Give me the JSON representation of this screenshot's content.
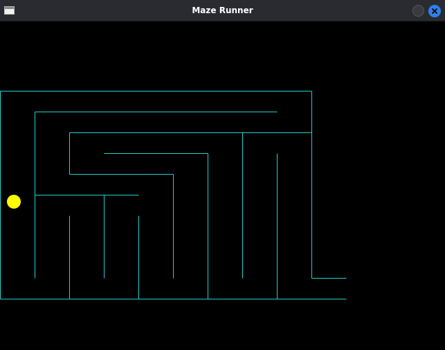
{
  "window": {
    "title": "Maze Runner",
    "icons": {
      "app": "window-icon",
      "minimize": "minimize-icon",
      "close": "close-icon"
    }
  },
  "colors": {
    "background": "#000000",
    "titlebar": "#2a2b30",
    "wall": "#22d3d3",
    "player": "#ffff00",
    "close_button": "#2f80ed"
  },
  "game": {
    "entities": {
      "player": "yellow-circle"
    }
  }
}
